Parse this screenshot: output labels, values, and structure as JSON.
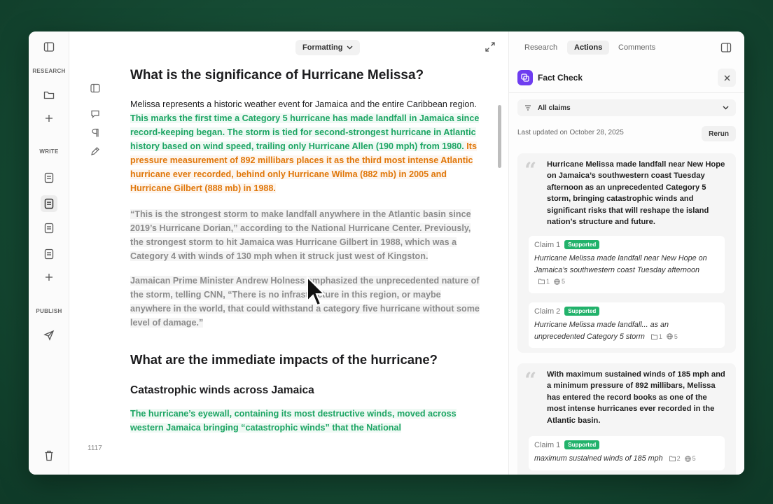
{
  "rail": {
    "research_label": "RESEARCH",
    "write_label": "WRITE",
    "publish_label": "PUBLISH"
  },
  "toolbar": {
    "formatting_label": "Formatting"
  },
  "editor": {
    "word_count": "1117",
    "h1": "What is the significance of Hurricane Melissa?",
    "p1_plain": "Melissa represents a historic weather event for Jamaica and the entire Caribbean region. ",
    "p1_green": "This marks the first time a Category 5 hurricane has made landfall in Jamaica since record-keeping began. The storm is tied for second-strongest hurricane in Atlantic history based on wind speed, trailing only Hurricane Allen (190 mph) from 1980.",
    "p1_orange": " Its pressure measurement of 892 millibars places it as the third most intense Atlantic hurricane ever recorded, behind only Hurricane Wilma (882 mb) in 2005 and Hurricane Gilbert (888 mb) in 1988.",
    "p2": "“This is the strongest storm to make landfall anywhere in the Atlantic basin since 2019’s Hurricane Dorian,” according to the National Hurricane Center. Previously, the strongest storm to hit Jamaica was Hurricane Gilbert in 1988, which was a Category 4 with winds of 130 mph when it struck just west of Kingston.",
    "p3": "Jamaican Prime Minister Andrew Holness emphasized the unprecedented nature of the storm, telling CNN, “There is no infrastructure in this region, or maybe anywhere in the world, that could withstand a category five hurricane without some level of damage.”",
    "h2": "What are the immediate impacts of the hurricane?",
    "h3": "Catastrophic winds across Jamaica",
    "p4_green": "The hurricane’s eyewall, containing its most destructive winds, moved across western Jamaica bringing “catastrophic winds” that the National"
  },
  "panel": {
    "tabs": [
      "Research",
      "Actions",
      "Comments"
    ],
    "fact_check_title": "Fact Check",
    "filter_label": "All claims",
    "last_updated": "Last updated on October 28, 2025",
    "rerun_label": "Rerun",
    "cards": [
      {
        "text": "Hurricane Melissa made landfall near New Hope on Jamaica’s southwestern coast Tuesday afternoon as an unprecedented Category 5 storm, bringing catastrophic winds and significant risks that will reshape the island nation’s structure and future.",
        "claims": [
          {
            "label": "Claim 1",
            "status": "Supported",
            "text": "Hurricane Melissa made landfall near New Hope on Jamaica’s southwestern coast Tuesday afternoon",
            "docs": "1",
            "links": "5"
          },
          {
            "label": "Claim 2",
            "status": "Supported",
            "text": "Hurricane Melissa made landfall... as an unprecedented Category 5 storm",
            "docs": "1",
            "links": "5"
          }
        ]
      },
      {
        "text": "With maximum sustained winds of 185 mph and a minimum pressure of 892 millibars, Melissa has entered the record books as one of the most intense hurricanes ever recorded in the Atlantic basin.",
        "claims": [
          {
            "label": "Claim 1",
            "status": "Supported",
            "text": "maximum sustained winds of 185 mph",
            "docs": "2",
            "links": "5"
          }
        ]
      }
    ]
  },
  "colors": {
    "green": "#1da564",
    "orange": "#e0770a",
    "badge": "#22b26b",
    "brand": "#6e3df0"
  }
}
